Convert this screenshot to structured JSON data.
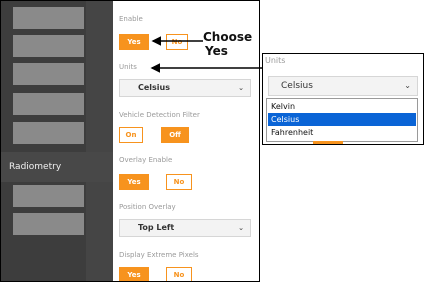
{
  "sidebar": {
    "items": [
      {
        "label": "Radiometry"
      }
    ]
  },
  "settings": {
    "enable": {
      "label": "Enable",
      "yes": "Yes",
      "no": "No"
    },
    "units": {
      "label": "Units",
      "value": "Celsius"
    },
    "vehicle_detection_filter": {
      "label": "Vehicle Detection Filter",
      "on": "On",
      "off": "Off"
    },
    "overlay_enable": {
      "label": "Overlay Enable",
      "yes": "Yes",
      "no": "No"
    },
    "position_overlay": {
      "label": "Position Overlay",
      "value": "Top Left"
    },
    "display_extreme_pixels": {
      "label": "Display Extreme Pixels",
      "yes": "Yes",
      "no": "No"
    }
  },
  "annotation": {
    "line1": "Choose",
    "line2": "Yes"
  },
  "units_dropdown": {
    "label": "Units",
    "value": "Celsius",
    "options": [
      "Kelvin",
      "Celsius",
      "Fahrenheit"
    ],
    "selected": "Celsius"
  },
  "colors": {
    "accent": "#f7931e",
    "selected_option": "#0a64d6",
    "sidebar": "#3d3d3d"
  }
}
